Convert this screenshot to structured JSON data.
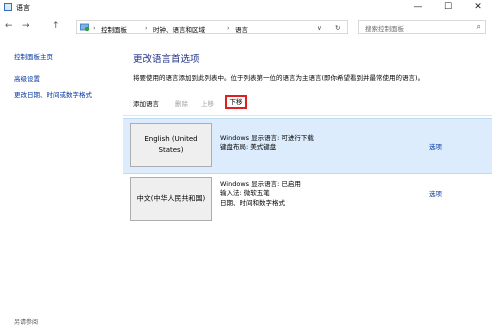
{
  "window": {
    "title": "语言",
    "minimize": "—",
    "maximize": "☐",
    "close": "✕"
  },
  "address": {
    "back_icon": "←",
    "forward_icon": "→",
    "up_icon": "↑",
    "path": [
      "控制面板",
      "时钟、语言和区域",
      "语言"
    ],
    "separator": "›",
    "dropdown_icon": "∨",
    "refresh_icon": "↻",
    "search_placeholder": "搜索控制面板",
    "search_icon": "⌕"
  },
  "sidebar": {
    "items": [
      {
        "label": "控制面板主页"
      },
      {
        "label": "高级设置"
      },
      {
        "label": "更改日期、时间或数字格式"
      }
    ],
    "bottom_label": "另请参阅"
  },
  "main": {
    "title": "更改语言首选项",
    "description": "将要使用的语言添加到此列表中。位于列表第一位的语言为主语言(即你希望看到并最常使用的语言)。",
    "toolbar": {
      "add": "添加语言",
      "remove": "删除",
      "move_up": "上移",
      "move_down": "下移"
    },
    "languages": [
      {
        "name": "English (United States)",
        "details": [
          "Windows 显示语言: 可进行下载",
          "键盘布局: 美式键盘"
        ],
        "options": "选项"
      },
      {
        "name": "中文(中华人民共和国)",
        "details": [
          "Windows 显示语言: 已启用",
          "输入法: 微软五笔",
          "日期、时间和数字格式"
        ],
        "options": "选项"
      }
    ]
  }
}
